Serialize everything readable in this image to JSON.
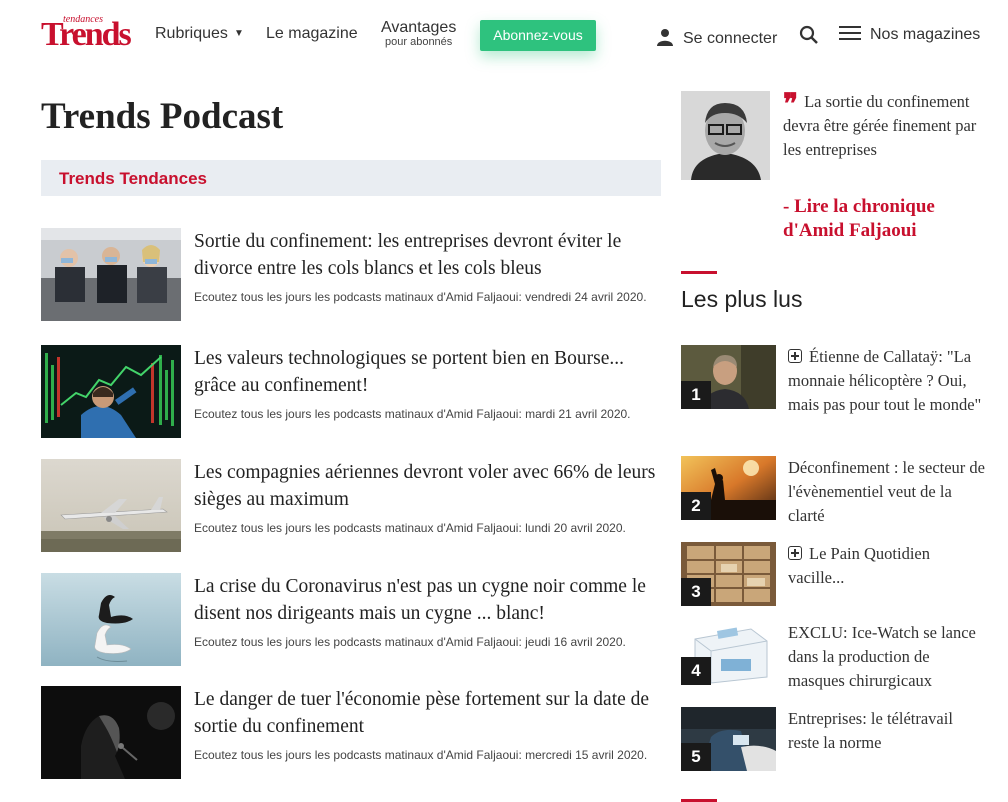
{
  "header": {
    "logo_small": "tendances",
    "logo_big": "Trends",
    "nav": {
      "rubriques": "Rubriques",
      "magazine": "Le magazine",
      "avantages": "Avantages",
      "avantages_sub": "pour abonnés"
    },
    "subscribe_label": "Abonnez-vous",
    "login_label": "Se connecter",
    "magazines_label": "Nos magazines",
    "icons": [
      "caret-down-icon",
      "user-icon",
      "search-icon",
      "menu-icon"
    ]
  },
  "page": {
    "title": "Trends Podcast",
    "section_label": "Trends Tendances"
  },
  "articles": [
    {
      "title": "Sortie du confinement: les entreprises devront éviter le divorce entre les cols blancs et les cols bleus",
      "meta": "Ecoutez tous les jours les podcasts matinaux d'Amid Faljaoui: vendredi 24 avril 2020."
    },
    {
      "title": "Les valeurs technologiques se portent bien en Bourse... grâce au confinement!",
      "meta": "Ecoutez tous les jours les podcasts matinaux d'Amid Faljaoui: mardi 21 avril 2020."
    },
    {
      "title": "Les compagnies aériennes devront voler avec 66% de leurs sièges au maximum",
      "meta": "Ecoutez tous les jours les podcasts matinaux d'Amid Faljaoui: lundi 20 avril 2020."
    },
    {
      "title": "La crise du Coronavirus n'est pas un cygne noir comme le disent nos dirigeants mais un cygne ... blanc!",
      "meta": "Ecoutez tous les jours les podcasts matinaux d'Amid Faljaoui: jeudi 16 avril 2020."
    },
    {
      "title": "Le danger de tuer l'économie pèse fortement sur la date de sortie du confinement",
      "meta": "Ecoutez tous les jours les podcasts matinaux d'Amid Faljaoui: mercredi 15 avril 2020."
    }
  ],
  "sidebar": {
    "quote_text": "La sortie du confinement devra être gérée finement par les entreprises",
    "quote_link": "- Lire la chronique d'Amid Faljaoui",
    "most_read_title": "Les plus lus",
    "most_read": [
      {
        "num": "1",
        "text": "Étienne de Callataÿ: \"La monnaie hélicoptère ? Oui, mais pas pour tout le monde\"",
        "premium": true
      },
      {
        "num": "2",
        "text": "Déconfinement : le secteur de l'évènementiel veut de la clarté",
        "premium": false
      },
      {
        "num": "3",
        "text": "Le Pain Quotidien vacille...",
        "premium": true
      },
      {
        "num": "4",
        "text": "EXCLU: Ice-Watch se lance dans la production de masques chirurgicaux",
        "premium": false
      },
      {
        "num": "5",
        "text": "Entreprises: le télétravail reste la norme",
        "premium": false
      }
    ]
  },
  "colors": {
    "brand_red": "#c8102e",
    "subscribe_green": "#2ec27e",
    "section_bg": "#e9edf2"
  }
}
